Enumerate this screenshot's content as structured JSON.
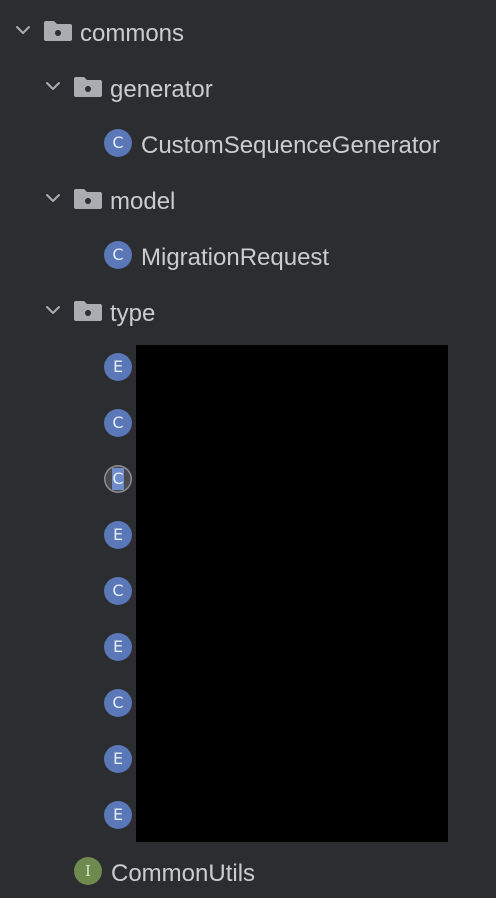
{
  "tree": {
    "commons": "commons",
    "generator": "generator",
    "custom_sequence_generator": "CustomSequenceGenerator",
    "model": "model",
    "migration_request": "MigrationRequest",
    "type": "type",
    "common_utils": "CommonUtils"
  },
  "badges": {
    "class": "C",
    "enum": "E",
    "interface": "I"
  },
  "icons": {
    "expand": "chevron-down-icon",
    "package": "package-folder-icon",
    "class": "class-icon",
    "enum": "enum-icon",
    "interface": "interface-icon"
  },
  "colors": {
    "background": "#2b2d30",
    "text": "#c9ccd1",
    "class_badge": "#5a78b8",
    "interface_badge": "#6f8a4e",
    "folder_icon": "#a9acb1",
    "redaction": "#000000"
  }
}
